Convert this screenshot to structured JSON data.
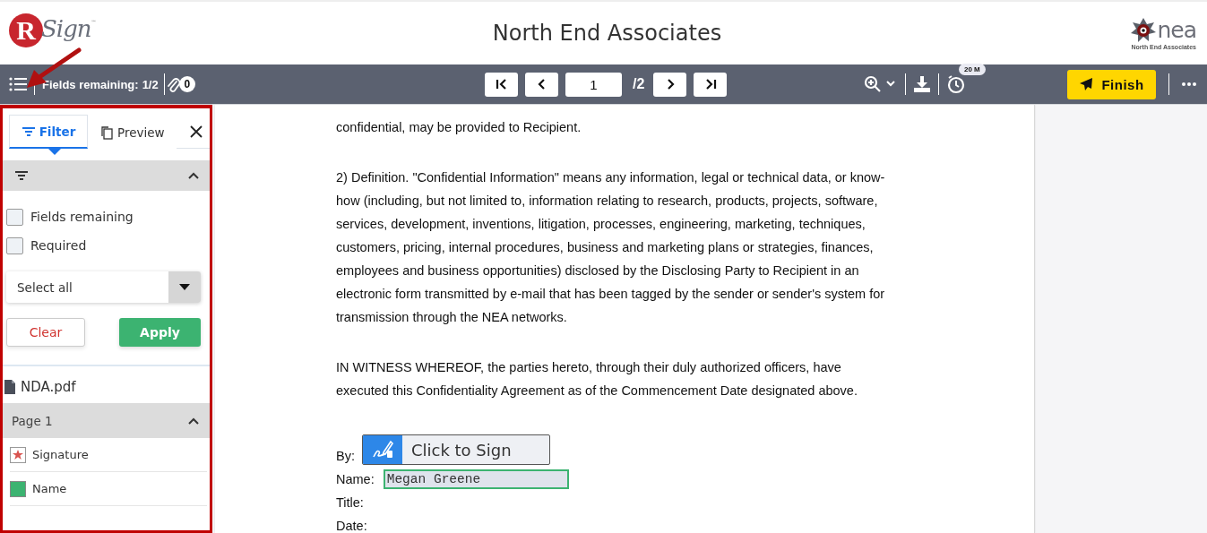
{
  "header": {
    "logo": {
      "letter": "R",
      "word": "Sign",
      "mark": "™"
    },
    "title": "North End Associates",
    "company_logo": {
      "word": "nea",
      "caption": "North End Associates"
    }
  },
  "toolbar": {
    "fields_label": "Fields remaining:",
    "fields_count": "1/2",
    "attachments_count": "0",
    "page_input": "1",
    "page_total": "/2",
    "timer_badge": "20 M",
    "finish": "Finish"
  },
  "sidebar": {
    "tabs": [
      {
        "label": "Filter",
        "selected": true
      },
      {
        "label": "Preview",
        "selected": false
      }
    ],
    "filter_section": {
      "expanded": true
    },
    "filters": [
      {
        "label": "Fields remaining",
        "checked": false
      },
      {
        "label": "Required",
        "checked": false
      }
    ],
    "select": "Select all",
    "clear": "Clear",
    "apply": "Apply",
    "file": "NDA.pdf",
    "page_group": {
      "label": "Page 1",
      "expanded": true,
      "fields": [
        {
          "label": "Signature",
          "kind": "signature"
        },
        {
          "label": "Name",
          "kind": "text"
        }
      ]
    }
  },
  "document": {
    "paragraphs": [
      [
        "confidential, may be provided to Recipient."
      ],
      [
        "2) Definition.  \"Confidential Information\" means any information, legal or technical data, or know-",
        "how (including, but not limited to, information relating to research, products, projects, software,",
        "services, development, inventions, litigation, processes, engineering, marketing, techniques,",
        "customers, pricing, internal procedures, business and marketing plans or strategies, finances,",
        "employees and business opportunities) disclosed by the Disclosing Party to Recipient in an",
        "electronic form transmitted by e-mail that has been tagged by the sender or sender's system for",
        "transmission through the NEA networks."
      ],
      [
        "IN WITNESS WHEREOF, the parties hereto, through their duly authorized officers, have",
        "executed this Confidentiality Agreement as of the Commencement Date designated above."
      ]
    ],
    "signature_rows": [
      {
        "label": "By:",
        "kind": "sign",
        "value": "Click to Sign"
      },
      {
        "label": "Name:",
        "kind": "text",
        "value": "Megan Greene"
      },
      {
        "label": "Title:",
        "kind": "blank"
      },
      {
        "label": "Date:",
        "kind": "blank"
      }
    ]
  }
}
